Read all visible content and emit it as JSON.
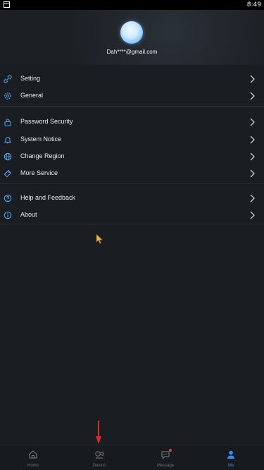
{
  "status_bar": {
    "time": "8:49"
  },
  "profile": {
    "email": "Dah****@gmail.com"
  },
  "menu": {
    "group1": [
      {
        "label": "Setting",
        "icon": "setting-link-icon"
      },
      {
        "label": "General",
        "icon": "gear-icon"
      }
    ],
    "group2": [
      {
        "label": "Password Security",
        "icon": "lock-icon"
      },
      {
        "label": "System Notice",
        "icon": "bell-icon"
      },
      {
        "label": "Change Region",
        "icon": "globe-icon"
      },
      {
        "label": "More Service",
        "icon": "tag-icon"
      }
    ],
    "group3": [
      {
        "label": "Help and Feedback",
        "icon": "question-icon"
      },
      {
        "label": "About",
        "icon": "info-icon"
      }
    ]
  },
  "tabbar": {
    "tabs": [
      {
        "label": "Home",
        "icon": "home-icon",
        "active": false
      },
      {
        "label": "Device",
        "icon": "camera-icon",
        "active": false
      },
      {
        "label": "Message",
        "icon": "message-icon",
        "active": false
      },
      {
        "label": "Me",
        "icon": "person-icon",
        "active": true
      }
    ]
  },
  "colors": {
    "background": "#1a1d22",
    "accent": "#3a8bef",
    "icon": "#5aa0e6",
    "badge": "#e5413c"
  }
}
